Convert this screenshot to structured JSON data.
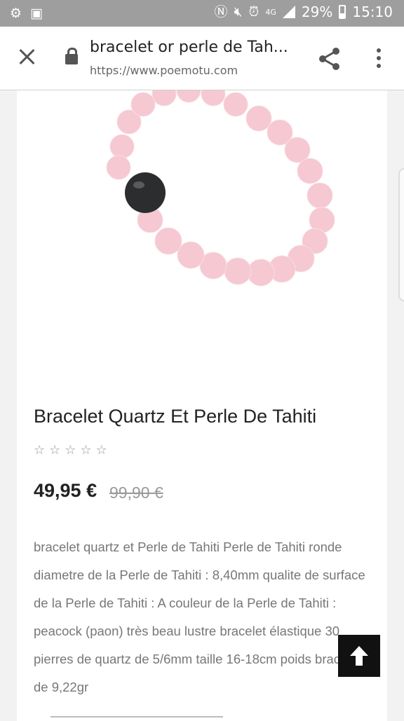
{
  "status_bar": {
    "battery": "29%",
    "time": "15:10",
    "network": "4G"
  },
  "browser": {
    "title": "bracelet or perle de Tah...",
    "url": "https://www.poemotu.com",
    "icons": [
      "close-icon",
      "lock-icon",
      "share-icon",
      "more-vert-icon"
    ]
  },
  "product": {
    "title": "Bracelet Quartz Et Perle De Tahiti",
    "rating_stars": 0,
    "rating_max": 5,
    "price": "49,95 €",
    "old_price": "99,90 €",
    "description": "bracelet quartz et Perle de Tahiti Perle de Tahiti ronde diametre de la Perle de Tahiti : 8,40mm qualite de surface de la Perle de Tahiti : A couleur de la Perle de Tahiti : peacock (paon) très beau lustre bracelet élastique 30 pierres de quartz de 5/6mm taille 16-18cm poids bracelet de 9,22gr"
  },
  "colors": {
    "status_bar": "#9e9e9e",
    "bead_pink": "#f4c6d0",
    "pearl": "#2b2d2e",
    "back_to_top": "#111111"
  }
}
